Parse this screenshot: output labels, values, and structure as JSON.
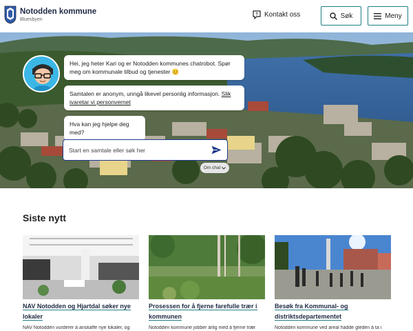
{
  "header": {
    "logo_title": "Notodden kommune",
    "logo_subtitle": "Bluesbyen",
    "contact_label": "Kontakt oss",
    "search_label": "Søk",
    "menu_label": "Meny",
    "accent_color": "#1e7d86"
  },
  "chatbot": {
    "messages": [
      "Hei, jeg heter Kari og er Notodden kommunes chatrobot. Spør meg om kommunale tilbud og tjenester 😊",
      "Samtalen er anonym, unngå likevel personlig informasjon.",
      "Hva kan jeg hjelpe deg med?"
    ],
    "privacy_link": "Slik ivaretar vi personvernet",
    "input_placeholder": "Start en samtale eller søk her",
    "about_label": "Om chat"
  },
  "news": {
    "section_title": "Siste nytt",
    "items": [
      {
        "title": "NAV Notodden og Hjartdal søker nye lokaler",
        "excerpt": "NAV Notodden vurderer å anskaffe nye lokaler, og"
      },
      {
        "title": "Prosessen for å fjerne farefulle trær i kommunen",
        "excerpt": "Notodden kommune jobber årlig med å fjerne trær"
      },
      {
        "title": "Besøk fra Kommunal- og distriktsdepartementet",
        "excerpt": "Notodden kommune ved areal hadde gleden å ta i"
      }
    ]
  }
}
